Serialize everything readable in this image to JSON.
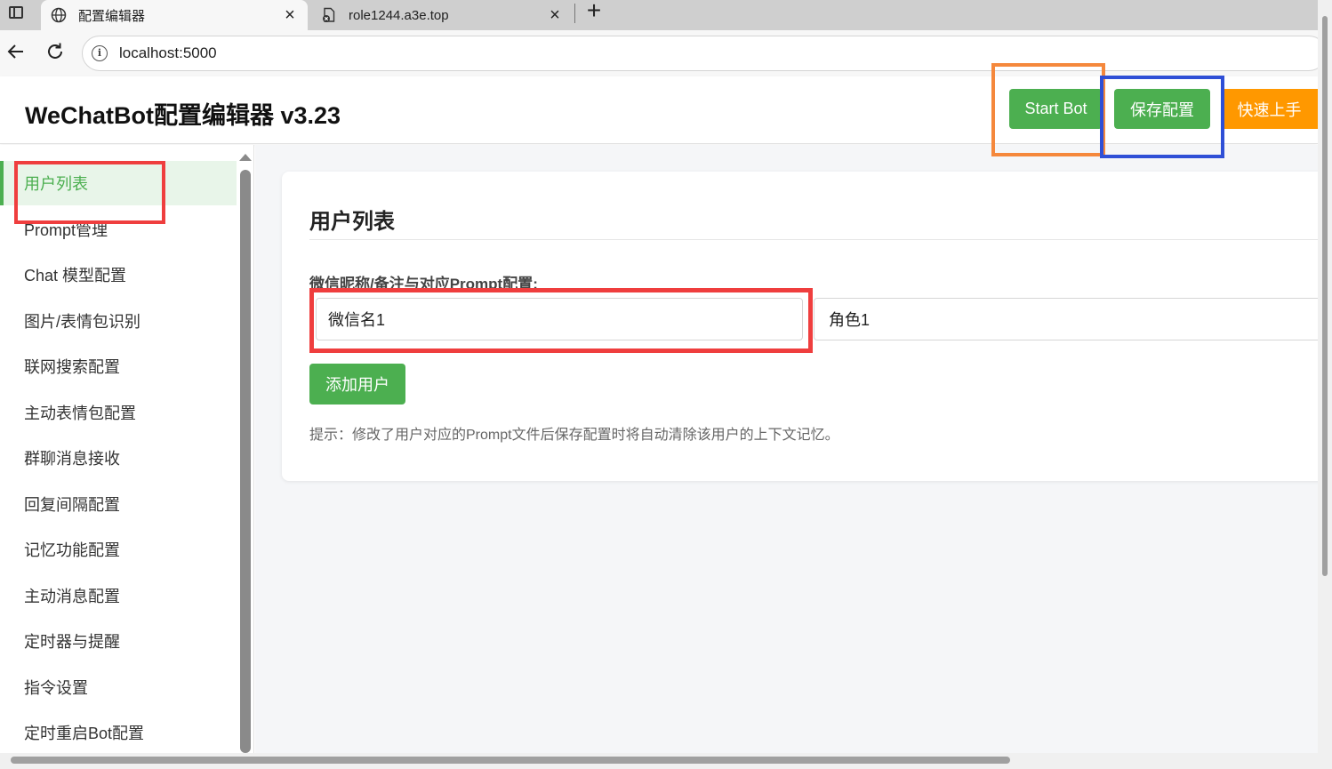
{
  "browser": {
    "tabs": [
      {
        "title": "配置编辑器",
        "icon": "globe-icon",
        "active": true
      },
      {
        "title": "role1244.a3e.top",
        "icon": "blocked-page-icon",
        "active": false
      }
    ],
    "new_tab_label": "+",
    "url": "localhost:5000"
  },
  "header": {
    "title": "WeChatBot配置编辑器 v3.23",
    "buttons": {
      "start": "Start Bot",
      "save": "保存配置",
      "quick_start": "快速上手"
    }
  },
  "sidebar": {
    "items": [
      {
        "label": "用户列表",
        "active": true
      },
      {
        "label": "Prompt管理"
      },
      {
        "label": "Chat 模型配置"
      },
      {
        "label": "图片/表情包识别"
      },
      {
        "label": "联网搜索配置"
      },
      {
        "label": "主动表情包配置"
      },
      {
        "label": "群聊消息接收"
      },
      {
        "label": "回复间隔配置"
      },
      {
        "label": "记忆功能配置"
      },
      {
        "label": "主动消息配置"
      },
      {
        "label": "定时器与提醒"
      },
      {
        "label": "指令设置"
      },
      {
        "label": "定时重启Bot配置"
      }
    ]
  },
  "main": {
    "section_title": "用户列表",
    "field_label": "微信昵称/备注与对应Prompt配置:",
    "users": [
      {
        "name": "微信名1",
        "role": "角色1"
      }
    ],
    "add_button": "添加用户",
    "hint": "提示：修改了用户对应的Prompt文件后保存配置时将自动清除该用户的上下文记忆。"
  },
  "colors": {
    "primary_green": "#4caf50",
    "accent_orange": "#ff9800",
    "annotation_red": "#ef3e3e",
    "annotation_orange": "#f5883c",
    "annotation_blue": "#2f4fd6"
  }
}
